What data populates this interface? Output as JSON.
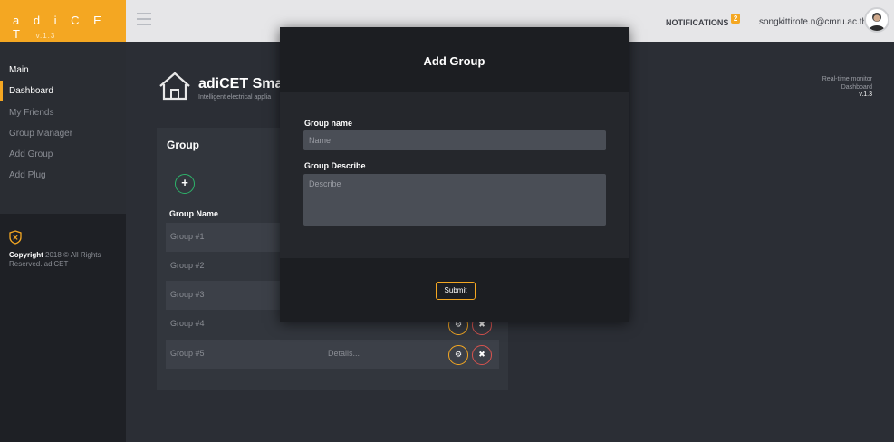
{
  "brand": {
    "name": "a d i C E T",
    "version": "v.1.3"
  },
  "topbar": {
    "notifications_label": "NOTIFICATIONS",
    "notifications_count": "2",
    "user_email": "songkittirote.n@cmru.ac.th"
  },
  "sidebar": {
    "heading": "Main",
    "items": [
      {
        "label": "Dashboard",
        "active": true
      },
      {
        "label": "My Friends"
      },
      {
        "label": "Group Manager"
      },
      {
        "label": "Add Group"
      },
      {
        "label": "Add Plug"
      }
    ],
    "copyright_bold": "Copyright",
    "copyright_rest": " 2018 © All Rights Reserved. adiCET"
  },
  "header": {
    "title": "adiCET Smar",
    "subtitle": "Intelligent electrical applia",
    "status_line1": "Real-time monitor",
    "status_line2": "Dashboard",
    "status_version": "v.1.3"
  },
  "group_panel": {
    "title": "Group",
    "add_symbol": "+",
    "column_name": "Group Name",
    "rows": [
      {
        "name": "Group #1",
        "details": ""
      },
      {
        "name": "Group #2",
        "details": ""
      },
      {
        "name": "Group #3",
        "details": ""
      },
      {
        "name": "Group #4",
        "details": ""
      },
      {
        "name": "Group #5",
        "details": "Details..."
      }
    ],
    "gear_symbol": "⚙",
    "delete_symbol": "✖"
  },
  "modal": {
    "title": "Add Group",
    "name_label": "Group name",
    "name_placeholder": "Name",
    "describe_label": "Group Describe",
    "describe_placeholder": "Describe",
    "submit_label": "Submit"
  },
  "colors": {
    "accent": "#f4a722",
    "add_green": "#2db36a",
    "delete_red": "#d9534f"
  }
}
